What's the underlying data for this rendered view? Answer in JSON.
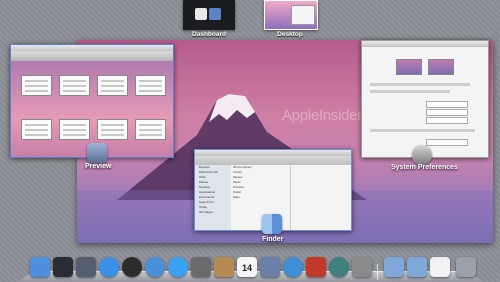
{
  "spaces": {
    "dashboard_label": "Dashboard",
    "desktop_label": "Desktop"
  },
  "desktop": {
    "watermark": "AppleInsider"
  },
  "windows": {
    "preview": {
      "label": "Preview",
      "icon": "preview-icon"
    },
    "finder": {
      "label": "Finder",
      "icon": "finder-icon",
      "sidebar_items": [
        "Devices",
        "Macintosh HD",
        "iDisk",
        "Places",
        "Desktop",
        "Applications",
        "Documents",
        "Search For",
        "Today",
        "All Images"
      ],
      "files": [
        "iPhoto Library",
        "Library",
        "Movies",
        "Music",
        "Pictures",
        "Public",
        "Sites"
      ]
    },
    "system_preferences": {
      "label": "System Preferences",
      "icon": "gears-icon"
    }
  },
  "dock": {
    "apps": [
      {
        "name": "finder-icon",
        "color": "#4f8fe0"
      },
      {
        "name": "dashboard-icon",
        "color": "#2a2d36"
      },
      {
        "name": "mission-control-icon",
        "color": "#555d70"
      },
      {
        "name": "app-store-icon",
        "color": "#3b8fe8"
      },
      {
        "name": "dashboard-gauge-icon",
        "color": "#2c2c2c"
      },
      {
        "name": "safari-icon",
        "color": "#4a90d9"
      },
      {
        "name": "ichat-icon",
        "color": "#3aa0f0"
      },
      {
        "name": "facetime-icon",
        "color": "#6a6a6a"
      },
      {
        "name": "address-book-icon",
        "color": "#b58a55"
      },
      {
        "name": "ical-icon",
        "color": "#f5f5f5"
      },
      {
        "name": "preview-icon",
        "color": "#6a80a8"
      },
      {
        "name": "itunes-icon",
        "color": "#3f8fd6"
      },
      {
        "name": "photo-booth-icon",
        "color": "#c0392b"
      },
      {
        "name": "time-machine-icon",
        "color": "#3f7f7f"
      },
      {
        "name": "system-preferences-icon",
        "color": "#8a8a8a"
      },
      {
        "name": "applications-folder-icon",
        "color": "#7fa7d8"
      },
      {
        "name": "documents-folder-icon",
        "color": "#7fa7d8"
      },
      {
        "name": "downloads-stack-icon",
        "color": "#f2f2f2"
      },
      {
        "name": "trash-icon",
        "color": "#9aa0a8"
      }
    ],
    "ical_date": "14"
  }
}
